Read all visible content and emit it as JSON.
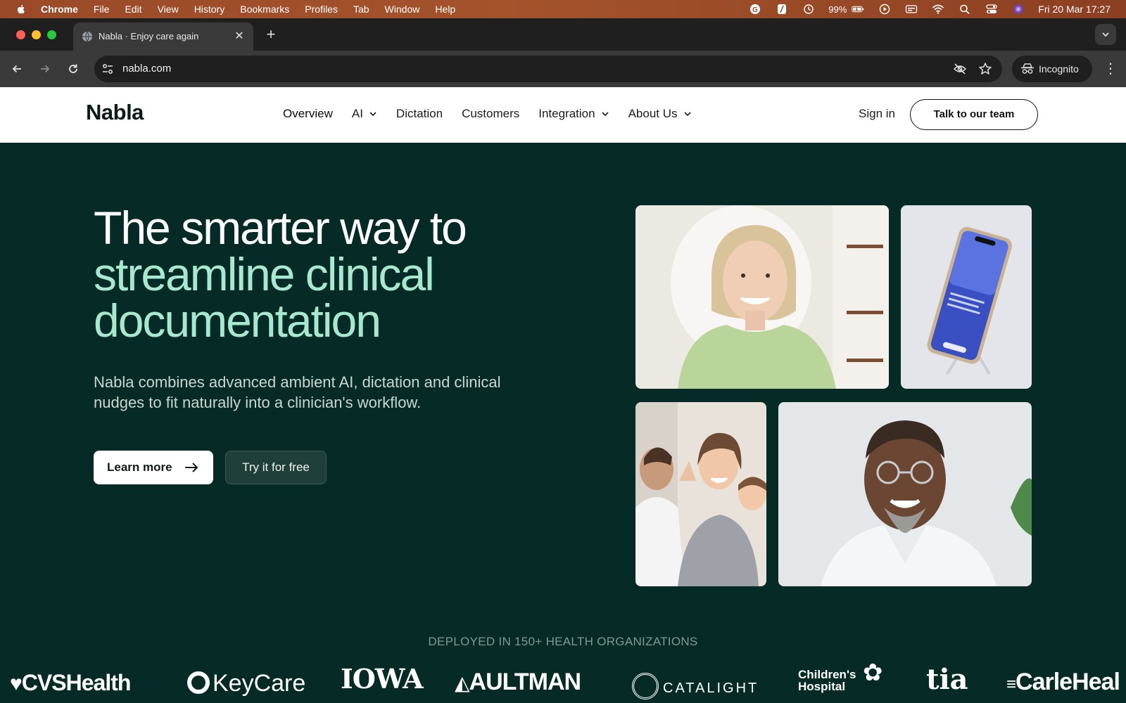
{
  "menubar": {
    "app_name": "Chrome",
    "items": [
      "File",
      "Edit",
      "View",
      "History",
      "Bookmarks",
      "Profiles",
      "Tab",
      "Window",
      "Help"
    ],
    "battery": "99%",
    "datetime": "Fri 20 Mar  17:27"
  },
  "browser": {
    "tab_title": "Nabla · Enjoy care again",
    "url": "nabla.com",
    "profile_label": "Incognito"
  },
  "site": {
    "logo": "Nabla",
    "nav": {
      "overview": "Overview",
      "ai": "AI",
      "dictation": "Dictation",
      "customers": "Customers",
      "integration": "Integration",
      "about": "About Us"
    },
    "sign_in": "Sign in",
    "cta_header": "Talk to our team"
  },
  "hero": {
    "headline_line1": "The smarter way to",
    "headline_line2": "streamline clinical",
    "headline_line3": "documentation",
    "subheadline": "Nabla combines advanced ambient AI, dictation and clinical nudges to fit naturally into a clinician's workflow.",
    "learn_more": "Learn more",
    "try_free": "Try it for free"
  },
  "customers": {
    "caption": "DEPLOYED IN 150+ HEALTH ORGANIZATIONS",
    "logos": {
      "cvs": "CVSHealth",
      "keycare": "KeyCare",
      "iowa": "IOWA",
      "aultman": "AULTMAN",
      "catalight": "CATALIGHT",
      "childrens_1": "Children's",
      "childrens_2": "Hospital",
      "tia": "tia",
      "carle": "CarleHeal"
    }
  },
  "colors": {
    "hero_bg": "#062b27",
    "headline_accent": "#a7e8cf",
    "menubar_bg": "#9a4a28"
  }
}
